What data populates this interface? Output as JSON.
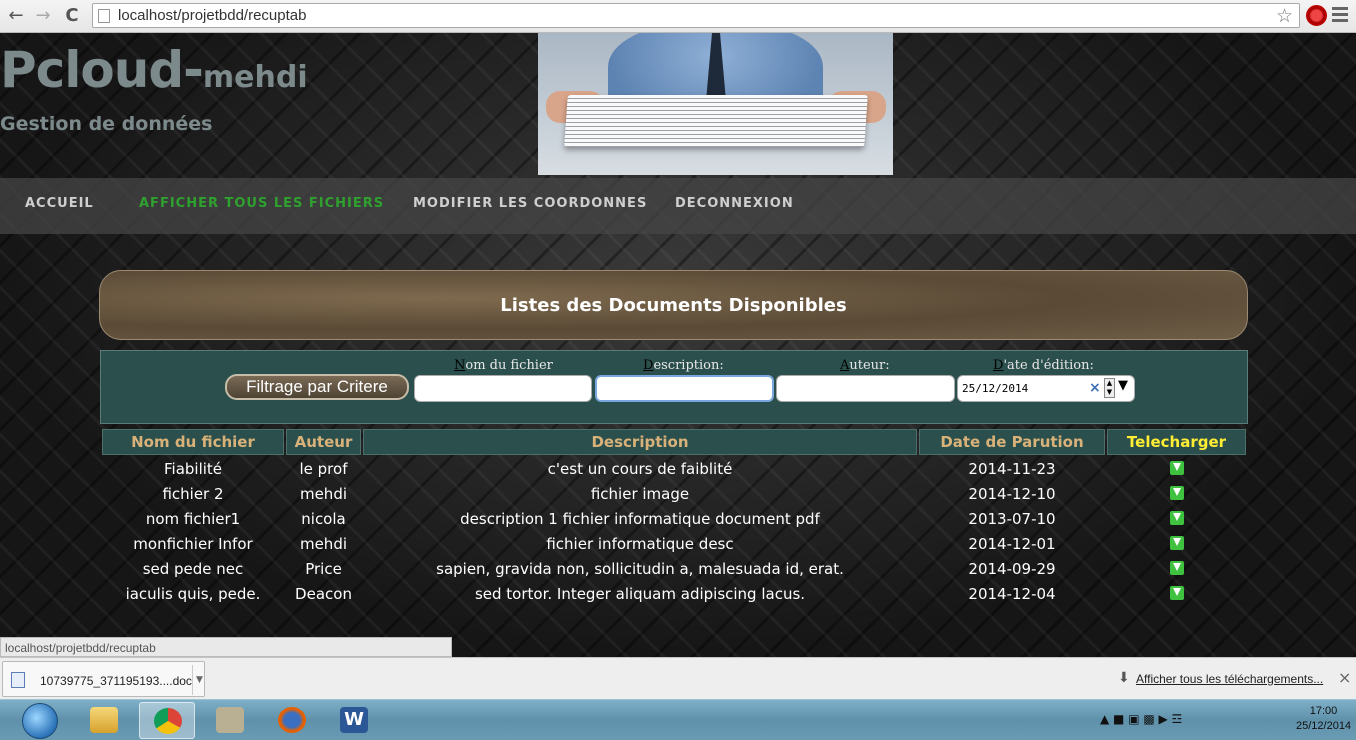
{
  "browser": {
    "url": "localhost/projetbdd/recuptab",
    "back_icon": "←",
    "forward_icon": "→",
    "reload_icon": "C"
  },
  "site": {
    "brand_main": "Pcloud-",
    "brand_sub": "mehdi",
    "tagline": "Gestion de données"
  },
  "nav": {
    "items": [
      {
        "label": "ACCUEIL"
      },
      {
        "label": "AFFICHER TOUS LES FICHIERS"
      },
      {
        "label": "MODIFIER LES COORDONNES"
      },
      {
        "label": "DECONNEXION"
      }
    ],
    "active_color": "#2ea12e"
  },
  "banner": {
    "title": "Listes des Documents Disponibles"
  },
  "filter": {
    "button_label": "Filtrage par Critere",
    "labels": {
      "nom": {
        "key": "N",
        "rest": "om du fichier"
      },
      "description": {
        "key": "D",
        "rest": "escription:"
      },
      "auteur": {
        "key": "A",
        "rest": "uteur:"
      },
      "date": {
        "key": "D",
        "rest": "'ate d'édition:"
      }
    },
    "values": {
      "nom": "",
      "description": "",
      "auteur": "",
      "date": "25/12/2014"
    }
  },
  "table": {
    "headers": [
      "Nom du fichier",
      "Auteur",
      "Description",
      "Date de Parution",
      "Telecharger"
    ],
    "rows": [
      {
        "nom": "Fiabilité",
        "auteur": "le prof",
        "description": "c'est un cours de faiblité",
        "date": "2014-11-23"
      },
      {
        "nom": "fichier 2",
        "auteur": "mehdi",
        "description": "fichier image",
        "date": "2014-12-10"
      },
      {
        "nom": "nom fichier1",
        "auteur": "nicola",
        "description": "description 1 fichier informatique document pdf",
        "date": "2013-07-10"
      },
      {
        "nom": "monfichier Infor",
        "auteur": "mehdi",
        "description": "fichier informatique desc",
        "date": "2014-12-01"
      },
      {
        "nom": "sed pede nec",
        "auteur": "Price",
        "description": "sapien, gravida non, sollicitudin a, malesuada id, erat.",
        "date": "2014-09-29"
      },
      {
        "nom": "iaculis quis, pede.",
        "auteur": "Deacon",
        "description": "sed tortor. Integer aliquam adipiscing lacus.",
        "date": "2014-12-04"
      }
    ]
  },
  "statusbar": {
    "text": "localhost/projetbdd/recuptab"
  },
  "downloads": {
    "file": "10739775_371195193....doc",
    "show_all": "Afficher tous les téléchargements..."
  },
  "taskbar": {
    "time": "17:00",
    "date": "25/12/2014"
  }
}
